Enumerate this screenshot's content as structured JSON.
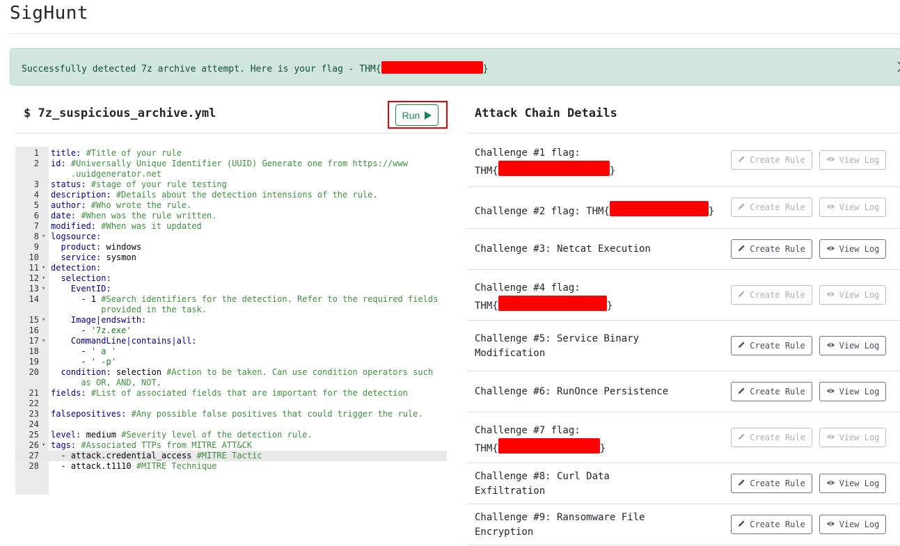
{
  "app": {
    "title": "SigHunt"
  },
  "alert": {
    "text": "Successfully detected 7z archive attempt. Here is your flag - THM{",
    "text_end": "}",
    "redacted": true,
    "bg_color": "#d1e7dd",
    "text_color": "#0f5132"
  },
  "editor": {
    "title": "$ 7z_suspicious_archive.yml",
    "run_label": "Run",
    "run_icon": "play-icon",
    "active_line": 27
  },
  "code_lines": [
    {
      "n": "1",
      "fold": false,
      "indent": 0,
      "parts": [
        [
          "k",
          "title:"
        ],
        [
          "c",
          " #Title of your rule"
        ]
      ]
    },
    {
      "n": "2",
      "fold": false,
      "indent": 0,
      "parts": [
        [
          "k",
          "id:"
        ],
        [
          "c",
          " #Universally Unique Identifier (UUID) Generate one from https://www"
        ]
      ]
    },
    {
      "n": "",
      "fold": false,
      "indent": 0,
      "parts": [
        [
          "c",
          "    .uuidgenerator.net"
        ]
      ]
    },
    {
      "n": "3",
      "fold": false,
      "indent": 0,
      "parts": [
        [
          "k",
          "status:"
        ],
        [
          "c",
          " #stage of your rule testing"
        ]
      ]
    },
    {
      "n": "4",
      "fold": false,
      "indent": 0,
      "parts": [
        [
          "k",
          "description:"
        ],
        [
          "c",
          " #Details about the detection intensions of the rule."
        ]
      ]
    },
    {
      "n": "5",
      "fold": false,
      "indent": 0,
      "parts": [
        [
          "k",
          "author:"
        ],
        [
          "c",
          " #Who wrote the rule."
        ]
      ]
    },
    {
      "n": "6",
      "fold": false,
      "indent": 0,
      "parts": [
        [
          "k",
          "date:"
        ],
        [
          "c",
          " #When was the rule written."
        ]
      ]
    },
    {
      "n": "7",
      "fold": false,
      "indent": 0,
      "parts": [
        [
          "k",
          "modified:"
        ],
        [
          "c",
          " #When was it updated"
        ]
      ]
    },
    {
      "n": "8",
      "fold": true,
      "indent": 0,
      "parts": [
        [
          "k",
          "logsource:"
        ]
      ]
    },
    {
      "n": "9",
      "fold": false,
      "indent": 1,
      "parts": [
        [
          "k",
          "product:"
        ],
        [
          "t",
          " windows"
        ]
      ]
    },
    {
      "n": "10",
      "fold": false,
      "indent": 1,
      "parts": [
        [
          "k",
          "service:"
        ],
        [
          "t",
          " sysmon"
        ]
      ]
    },
    {
      "n": "11",
      "fold": true,
      "indent": 0,
      "parts": [
        [
          "k",
          "detection:"
        ]
      ]
    },
    {
      "n": "12",
      "fold": true,
      "indent": 1,
      "parts": [
        [
          "k",
          "selection:"
        ]
      ]
    },
    {
      "n": "13",
      "fold": true,
      "indent": 2,
      "parts": [
        [
          "k",
          "EventID:"
        ]
      ]
    },
    {
      "n": "14",
      "fold": false,
      "indent": 3,
      "parts": [
        [
          "t",
          "- 1"
        ],
        [
          "c",
          " #Search identifiers for the detection. Refer to the required fields"
        ]
      ]
    },
    {
      "n": "",
      "fold": false,
      "indent": 3,
      "parts": [
        [
          "c",
          "    provided in the task."
        ]
      ]
    },
    {
      "n": "15",
      "fold": true,
      "indent": 2,
      "parts": [
        [
          "k",
          "Image|endswith:"
        ]
      ]
    },
    {
      "n": "16",
      "fold": false,
      "indent": 3,
      "parts": [
        [
          "t",
          "- "
        ],
        [
          "s",
          "'7z.exe'"
        ]
      ]
    },
    {
      "n": "17",
      "fold": true,
      "indent": 2,
      "parts": [
        [
          "k",
          "CommandLine|contains|all:"
        ]
      ]
    },
    {
      "n": "18",
      "fold": false,
      "indent": 3,
      "parts": [
        [
          "t",
          "- "
        ],
        [
          "s",
          "' a '"
        ]
      ]
    },
    {
      "n": "19",
      "fold": false,
      "indent": 3,
      "parts": [
        [
          "t",
          "- "
        ],
        [
          "s",
          "' -p'"
        ]
      ]
    },
    {
      "n": "20",
      "fold": false,
      "indent": 1,
      "parts": [
        [
          "k",
          "condition:"
        ],
        [
          "t",
          " selection"
        ],
        [
          "c",
          " #Action to be taken. Can use condition operators such"
        ]
      ]
    },
    {
      "n": "",
      "fold": false,
      "indent": 1,
      "parts": [
        [
          "c",
          "    as OR, AND, NOT,"
        ]
      ]
    },
    {
      "n": "21",
      "fold": false,
      "indent": 0,
      "parts": [
        [
          "k",
          "fields:"
        ],
        [
          "c",
          " #List of associated fields that are important for the detection"
        ]
      ]
    },
    {
      "n": "22",
      "fold": false,
      "indent": 0,
      "parts": []
    },
    {
      "n": "23",
      "fold": false,
      "indent": 0,
      "parts": [
        [
          "k",
          "falsepositives:"
        ],
        [
          "c",
          " #Any possible false positives that could trigger the rule."
        ]
      ]
    },
    {
      "n": "24",
      "fold": false,
      "indent": 0,
      "parts": []
    },
    {
      "n": "25",
      "fold": false,
      "indent": 0,
      "parts": [
        [
          "k",
          "level:"
        ],
        [
          "t",
          " medium"
        ],
        [
          "c",
          " #Severity level of the detection rule."
        ]
      ]
    },
    {
      "n": "26",
      "fold": true,
      "indent": 0,
      "parts": [
        [
          "k",
          "tags:"
        ],
        [
          "c",
          " #Associated TTPs from MITRE ATT&CK"
        ]
      ]
    },
    {
      "n": "27",
      "fold": false,
      "indent": 1,
      "parts": [
        [
          "t",
          "- attack.credential_access"
        ],
        [
          "c",
          " #MITRE Tactic"
        ]
      ]
    },
    {
      "n": "28",
      "fold": false,
      "indent": 1,
      "parts": [
        [
          "t",
          "- attack.t1110"
        ],
        [
          "c",
          " #MITRE Technique"
        ]
      ]
    }
  ],
  "attack_chain": {
    "title": "Attack Chain Details",
    "create_label": "Create Rule",
    "view_label": "View Log",
    "create_icon": "pencil-icon",
    "view_icon": "eye-icon",
    "challenges": [
      {
        "label": "Challenge #1 flag:",
        "flag_prefix": "THM{",
        "flag_suffix": "}",
        "redacted": true,
        "wrap": true,
        "enabled": false
      },
      {
        "label": "Challenge #2 flag: THM{",
        "flag_prefix": "",
        "flag_suffix": "}",
        "redacted": true,
        "wrap": false,
        "enabled": false
      },
      {
        "label": "Challenge #3: Netcat Execution",
        "redacted": false,
        "enabled": true
      },
      {
        "label": "Challenge #4 flag:",
        "flag_prefix": "THM{",
        "flag_suffix": "}",
        "redacted": true,
        "wrap": true,
        "enabled": false
      },
      {
        "label": "Challenge #5: Service Binary Modification",
        "redacted": false,
        "enabled": true
      },
      {
        "label": "Challenge #6: RunOnce Persistence",
        "redacted": false,
        "enabled": true
      },
      {
        "label": "Challenge #7 flag:",
        "flag_prefix": "THM{",
        "flag_suffix": "}",
        "redacted": true,
        "wrap": true,
        "enabled": false
      },
      {
        "label": "Challenge #8: Curl Data Exfiltration",
        "redacted": false,
        "enabled": true
      },
      {
        "label": "Challenge #9: Ransomware File Encryption",
        "redacted": false,
        "enabled": true
      }
    ]
  }
}
